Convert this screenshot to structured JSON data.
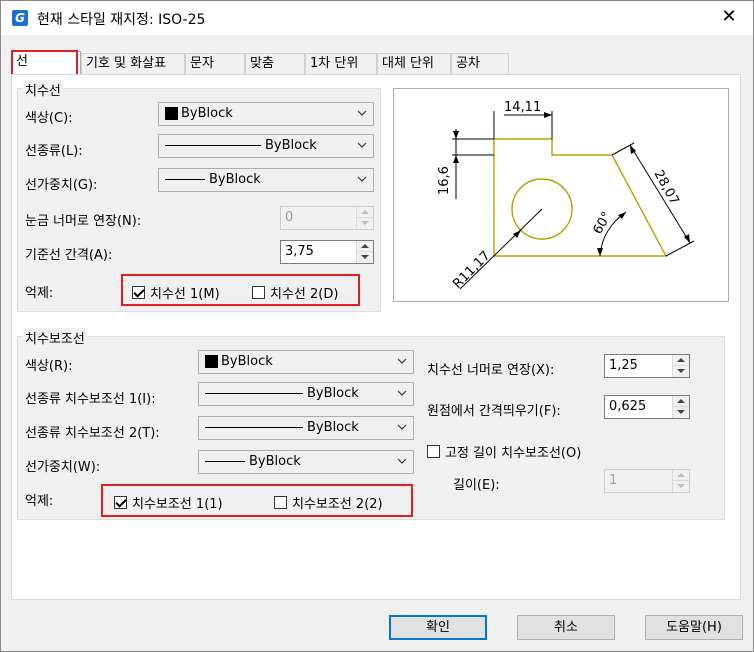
{
  "title": "현재 스타일 재지정: ISO-25",
  "close_glyph": "✕",
  "app_icon_letter": "G",
  "tabs": [
    "선",
    "기호 및 화살표",
    "문자",
    "맞춤",
    "1차 단위",
    "대체 단위",
    "공차"
  ],
  "dim_lines": {
    "group_label": "치수선",
    "color_label": "색상(C):",
    "color_value": "ByBlock",
    "linetype_label": "선종류(L):",
    "linetype_value": "ByBlock",
    "lineweight_label": "선가중치(G):",
    "lineweight_value": "ByBlock",
    "extend_ticks_label": "눈금 너머로 연장(N):",
    "extend_ticks_value": "0",
    "baseline_spacing_label": "기준선 간격(A):",
    "baseline_spacing_value": "3,75",
    "suppress_label": "억제:",
    "suppress_1_label": "치수선 1(M)",
    "suppress_1_checked": true,
    "suppress_2_label": "치수선 2(D)",
    "suppress_2_checked": false
  },
  "ext_lines": {
    "group_label": "치수보조선",
    "color_label": "색상(R):",
    "color_value": "ByBlock",
    "linetype1_label": "선종류 치수보조선 1(I):",
    "linetype1_value": "ByBlock",
    "linetype2_label": "선종류 치수보조선 2(T):",
    "linetype2_value": "ByBlock",
    "lineweight_label": "선가중치(W):",
    "lineweight_value": "ByBlock",
    "suppress_label": "억제:",
    "suppress_1_label": "치수보조선 1(1)",
    "suppress_1_checked": true,
    "suppress_2_label": "치수보조선 2(2)",
    "suppress_2_checked": false,
    "extend_beyond_label": "치수선 너머로 연장(X):",
    "extend_beyond_value": "1,25",
    "offset_origin_label": "원점에서 간격띄우기(F):",
    "offset_origin_value": "0,625",
    "fixed_length_label": "고정 길이 치수보조선(O)",
    "fixed_length_checked": false,
    "length_label": "길이(E):",
    "length_value": "1"
  },
  "preview": {
    "dim_top": "14,11",
    "dim_left": "16,6",
    "dim_diag": "28,07",
    "dim_angle": "60°",
    "dim_radius": "R11,17"
  },
  "buttons": {
    "ok": "확인",
    "cancel": "취소",
    "help": "도움말(H)"
  },
  "colors": {
    "highlight_red": "#e02020",
    "shape_yellow": "#b8a000",
    "default_button_border": "#0078d7"
  }
}
